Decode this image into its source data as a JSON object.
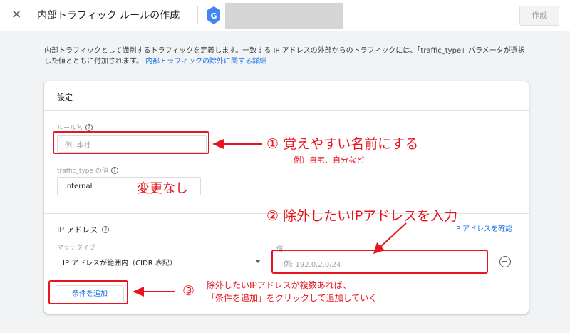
{
  "header": {
    "close": "✕",
    "title": "内部トラフィック ルールの作成",
    "create_button": "作成"
  },
  "description": {
    "text": "内部トラフィックとして識別するトラフィックを定義します。一致する IP アドレスの外部からのトラフィックには、「traffic_type」パラメータが選択した値とともに付加されます。",
    "link": "内部トラフィックの除外に関する詳細"
  },
  "card": {
    "title": "設定",
    "rule_name": {
      "label": "ルール名",
      "placeholder": "例: 本社"
    },
    "traffic_type": {
      "label": "traffic_type の値",
      "value": "internal"
    },
    "ip_section": {
      "title": "IP アドレス",
      "check_link": "IP アドレスを確認",
      "match_type_label": "マッチタイプ",
      "match_type_value": "IP アドレスが範囲内（CIDR 表記）",
      "value_label": "値",
      "value_placeholder": "例: 192.0.2.0/24"
    },
    "add_condition_button": "条件を追加"
  },
  "annotations": {
    "a1_main": "① 覚えやすい名前にする",
    "a1_sub": "例）自宅、自分など",
    "a_nochange": "変更なし",
    "a2_main": "② 除外したいIPアドレスを入力",
    "a3_num": "③",
    "a3_line1": "除外したいIPアドレスが複数あれば、",
    "a3_line2": "「条件を追加」をクリックして追加していく"
  },
  "colors": {
    "accent": "#1a73e8",
    "annotation": "#e8141e"
  }
}
